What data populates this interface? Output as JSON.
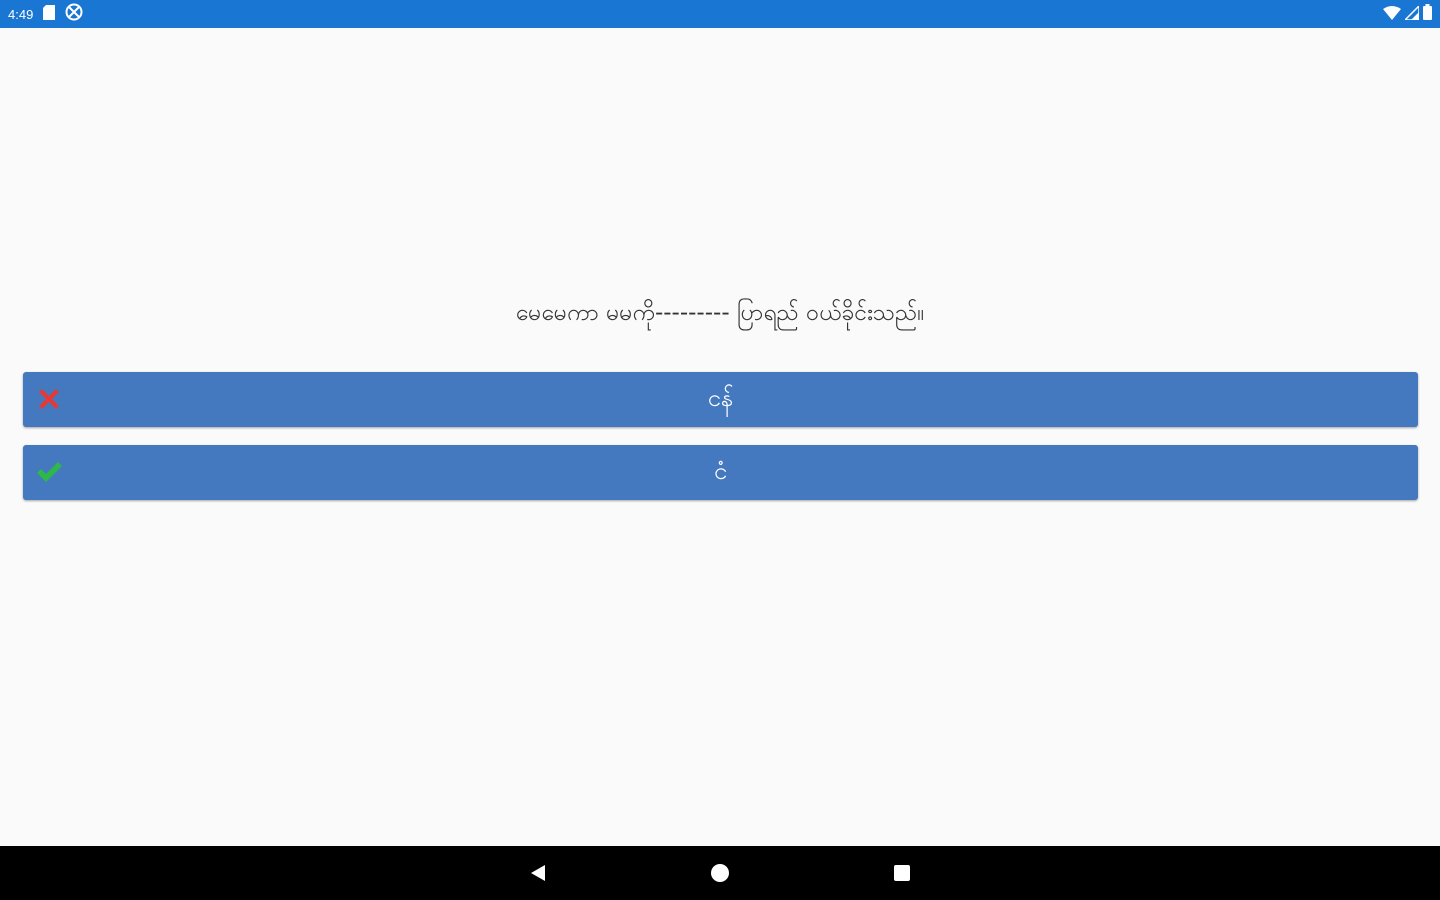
{
  "status_bar": {
    "time": "4:49",
    "icons": [
      "sd-card-icon",
      "accessibility-icon",
      "wifi-icon",
      "signal-icon",
      "battery-icon"
    ]
  },
  "quiz": {
    "question": "မေမေကာ မမကို--------- ပြာရည် ဝယ်ခိုင်းသည်။",
    "answers": [
      {
        "label": "ငန်",
        "status": "incorrect",
        "icon": "cross-icon",
        "icon_color": "#e53935"
      },
      {
        "label": "ငံ",
        "status": "correct",
        "icon": "check-icon",
        "icon_color": "#2fb84a"
      }
    ],
    "button_color": "#4479c0"
  },
  "nav_bar": {
    "buttons": [
      "back-icon",
      "home-icon",
      "recents-icon"
    ]
  }
}
